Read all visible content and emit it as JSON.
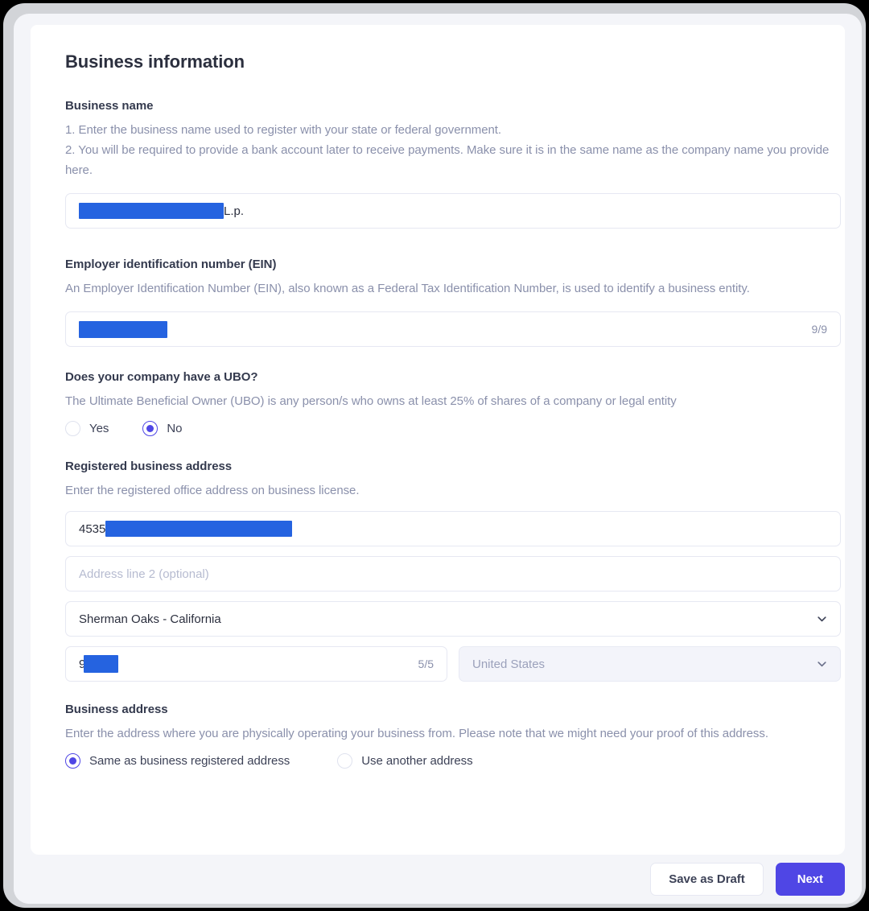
{
  "page": {
    "title": "Business information"
  },
  "sections": {
    "business_name": {
      "label": "Business name",
      "help_line1": "1. Enter the business name used to register with your state or federal government.",
      "help_line2": "2. You will be required to provide a bank account later to receive payments. Make sure it is in the same name as the company name you provide here.",
      "value_suffix": "L.p.",
      "redacted": true
    },
    "ein": {
      "label": "Employer identification number (EIN)",
      "help": "An Employer Identification Number (EIN), also known as a Federal Tax Identification Number, is used to identify a business entity.",
      "counter": "9/9",
      "redacted": true
    },
    "ubo": {
      "label": "Does your company have a UBO?",
      "help": "The Ultimate Beneficial Owner (UBO) is any person/s who owns at least 25% of shares of a company or legal entity",
      "options": [
        {
          "label": "Yes",
          "selected": false
        },
        {
          "label": "No",
          "selected": true
        }
      ]
    },
    "registered_address": {
      "label": "Registered business address",
      "help": "Enter the registered office address on business license.",
      "line1_prefix": "4535",
      "line2_placeholder": "Address line 2 (optional)",
      "line2_value": "",
      "city_state": "Sherman Oaks - California",
      "zip_prefix": "9",
      "zip_counter": "5/5",
      "country": "United States",
      "country_disabled": true
    },
    "business_address": {
      "label": "Business address",
      "help": "Enter the address where you are physically operating your business from. Please note that we might need your proof of this address.",
      "options": [
        {
          "label": "Same as business registered address",
          "selected": true
        },
        {
          "label": "Use another address",
          "selected": false
        }
      ]
    }
  },
  "footer": {
    "save_draft_label": "Save as Draft",
    "next_label": "Next"
  },
  "colors": {
    "accent": "#4f46e5",
    "redaction": "#2563e0",
    "heading": "#2b2f3e",
    "muted_text": "#8a90ab",
    "border": "#e6e8f2",
    "page_bg": "#f4f5f9"
  }
}
